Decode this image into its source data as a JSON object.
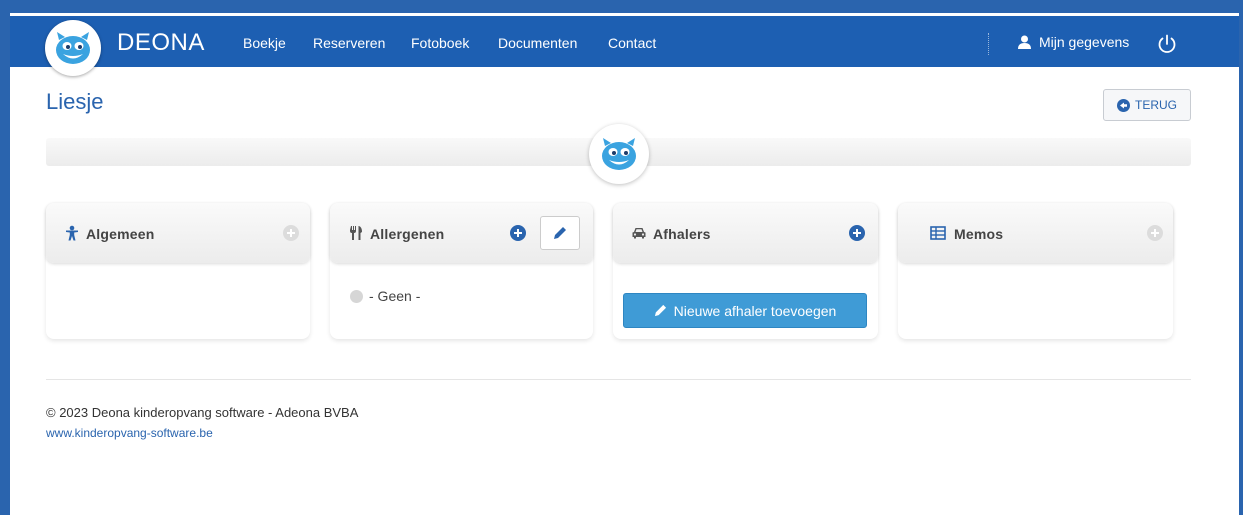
{
  "app": {
    "brand": "DEONA",
    "nav": [
      "Boekje",
      "Reserveren",
      "Fotoboek",
      "Documenten",
      "Contact"
    ],
    "user_label": "Mijn gegevens"
  },
  "page": {
    "title": "Liesje",
    "back_label": "TERUG"
  },
  "panels": {
    "algemeen": {
      "label": "Algemeen"
    },
    "allergenen": {
      "label": "Allergenen",
      "value": "- Geen -"
    },
    "afhalers": {
      "label": "Afhalers",
      "add_button": "Nieuwe afhaler toevoegen"
    },
    "memos": {
      "label": "Memos"
    }
  },
  "footer": {
    "copyright": "© 2023 Deona kinderopvang software - Adeona BVBA",
    "website": "www.kinderopvang-software.be"
  },
  "colors": {
    "navbar": "#1d5fb2",
    "frame": "#2a64ae",
    "accent": "#3f9bd6",
    "title": "#2a64ae"
  },
  "icons": {
    "algemeen": "child-icon",
    "allergenen": "cutlery-icon",
    "afhalers": "car-icon",
    "memos": "table-icon",
    "user": "user-icon",
    "logout": "power-icon",
    "back": "arrow-left-circle-icon",
    "edit": "pencil-icon",
    "add": "plus-circle-icon"
  }
}
